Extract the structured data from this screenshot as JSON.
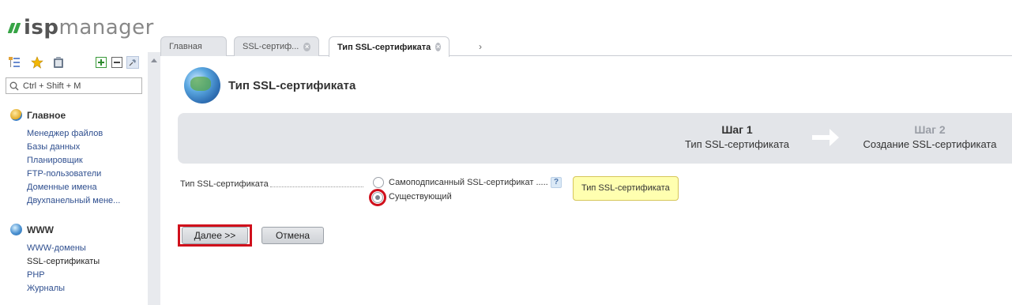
{
  "logo": {
    "part1": "isp",
    "part2": "manager"
  },
  "sidebar": {
    "search_placeholder": "Ctrl + Shift + M",
    "sections": [
      {
        "title": "Главное",
        "items": [
          "Менеджер файлов",
          "Базы данных",
          "Планировщик",
          "FTP-пользователи",
          "Доменные имена",
          "Двухпанельный мене..."
        ]
      },
      {
        "title": "WWW",
        "items": [
          "WWW-домены",
          "SSL-сертификаты",
          "PHP",
          "Журналы"
        ]
      }
    ]
  },
  "tabs": [
    {
      "label": "Главная"
    },
    {
      "label": "SSL-сертиф..."
    },
    {
      "label": "Тип SSL-сертификата"
    }
  ],
  "page": {
    "title": "Тип SSL-сертификата",
    "steps": [
      {
        "num": "Шаг 1",
        "label": "Тип SSL-сертификата"
      },
      {
        "num": "Шаг 2",
        "label": "Создание SSL-сертификата"
      }
    ],
    "field_label": "Тип SSL-сертификата",
    "options": [
      {
        "label": "Самоподписанный SSL-сертификат",
        "selected": false
      },
      {
        "label": "Существующий",
        "selected": true
      }
    ],
    "help": "?",
    "tooltip": "Тип SSL-сертификата",
    "buttons": {
      "next": "Далее >>",
      "cancel": "Отмена"
    }
  },
  "colors": {
    "accent_green": "#37a446",
    "highlight_red": "#d0101c",
    "link": "#2f4f8f"
  }
}
